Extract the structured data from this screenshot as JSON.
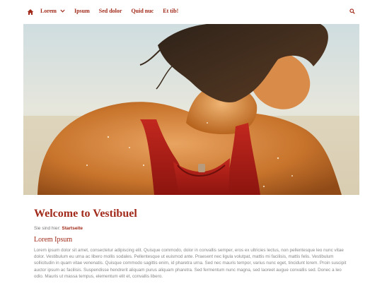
{
  "nav": {
    "items": [
      {
        "label": "Lorem",
        "has_dropdown": true
      },
      {
        "label": "Ipsum"
      },
      {
        "label": "Sed dolor"
      },
      {
        "label": "Quid nuc"
      },
      {
        "label": "Et tib!"
      }
    ],
    "home_icon": "home-icon",
    "search_icon": "search-icon"
  },
  "hero": {
    "alt": "Photo of a woman in a red swimsuit seen from behind"
  },
  "page": {
    "title": "Welcome to Vestibuel",
    "breadcrumb_prefix": "Sie sind hier:",
    "breadcrumb_link": "Startseite",
    "subtitle": "Lorem Ipsum",
    "paragraph": "Lorem ipsum dolor sit amet, consectetur adipiscing elit. Quisque commodo, dolor in convallis semper, eros ex ultricies lectus, non pellentesque leo nunc vitae dolor. Vestibulum eu urna ac libero mollis sodales. Pellentesque ut euismod ante. Praesent nec ligula volutpat, mattis mi facilisis, mattis felis. Vestibulum sollicitudin in quam vitae venenatis. Quisque commodo sagittis enim, id pharetra urna. Sed nec mauris tempor, varius nunc eget, tincidunt lorem. Proin suscipit auctor ipsum ac facilisis. Suspendisse hendrerit aliquam purus aliquam pharetra. Sed fermentum nunc magna, sed laoreet augue convallis sed. Donec a leo odio. Mauris ut massa tempus, elementum elit et, convallis libero."
  },
  "colors": {
    "accent": "#a12a1a",
    "text_muted": "#888888"
  }
}
